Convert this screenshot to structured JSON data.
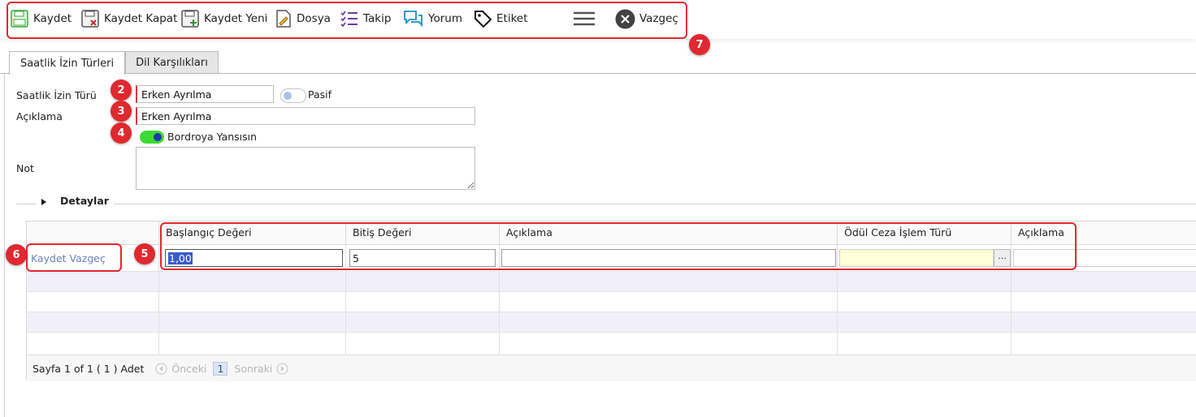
{
  "toolbar": {
    "buttons": [
      {
        "label": "Kaydet",
        "icon": "save-icon"
      },
      {
        "label": "Kaydet Kapat",
        "icon": "save-close-icon"
      },
      {
        "label": "Kaydet Yeni",
        "icon": "save-new-icon"
      },
      {
        "label": "Dosya",
        "icon": "file-attach-icon"
      },
      {
        "label": "Takip",
        "icon": "checklist-icon"
      },
      {
        "label": "Yorum",
        "icon": "comment-icon"
      },
      {
        "label": "Etiket",
        "icon": "tag-icon"
      },
      {
        "label": "",
        "icon": "hamburger-menu-icon"
      },
      {
        "label": "Vazgeç",
        "icon": "close-circle-icon"
      }
    ]
  },
  "badges": {
    "b2": "2",
    "b3": "3",
    "b4": "4",
    "b5": "5",
    "b6": "6",
    "b7": "7"
  },
  "tabs": [
    {
      "label": "Saatlik İzin Türleri",
      "active": true
    },
    {
      "label": "Dil Karşılıkları",
      "active": false
    }
  ],
  "form": {
    "type_label": "Saatlik İzin Türü",
    "type_value": "Erken Ayrılma",
    "passive_label": "Pasif",
    "passive_on": false,
    "desc_label": "Açıklama",
    "desc_value": "Erken Ayrılma",
    "payroll_label": "Bordroya Yansısın",
    "payroll_on": true,
    "note_label": "Not",
    "note_value": ""
  },
  "details": {
    "title": "Detaylar",
    "row_actions": "Kaydet Vazgeç",
    "columns": [
      "Başlangıç Değeri",
      "Bitiş Değeri",
      "Açıklama",
      "Ödül Ceza İşlem Türü",
      "Açıklama"
    ],
    "edit_row": {
      "start": "1,00",
      "end": "5",
      "desc": "",
      "reward_type": "",
      "reward_desc": ""
    },
    "browse_label": "···"
  },
  "pager": {
    "info": "Sayfa 1 of 1 ( 1 ) Adet",
    "prev": "Önceki",
    "page": "1",
    "next": "Sonraki"
  },
  "colors": {
    "accent_red": "#e0282f",
    "toggle_green": "#3adb34",
    "selection_blue": "#3b5bcc",
    "yellow_field": "#ffffd8"
  }
}
